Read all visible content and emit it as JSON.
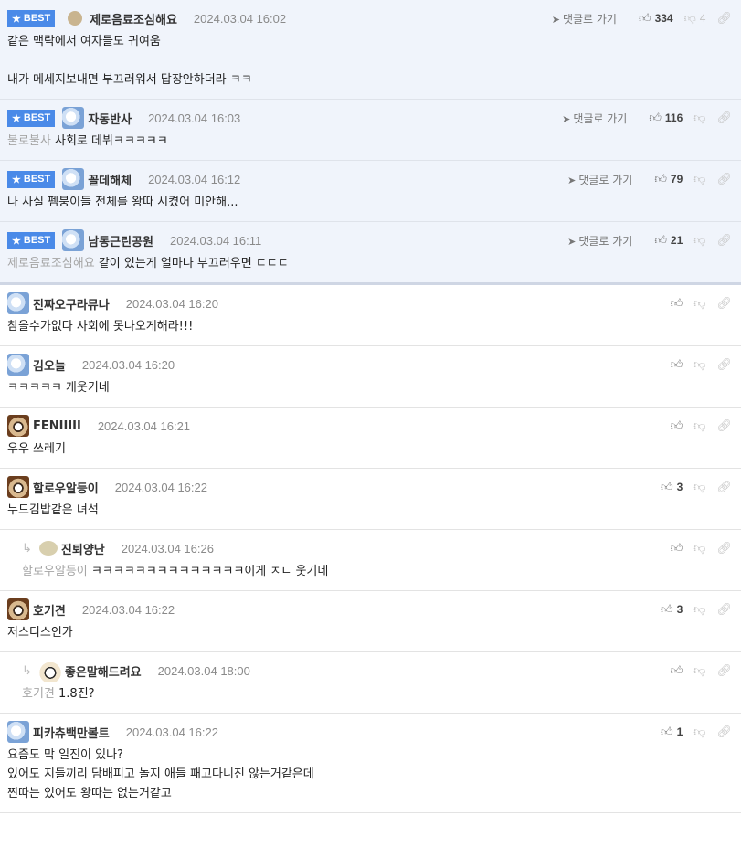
{
  "goto_label": "댓글로 가기",
  "best_label": "BEST",
  "comments": [
    {
      "kind": "best",
      "nick": "제로음료조심해요",
      "date": "2024.03.04 16:02",
      "up": "334",
      "down": "4",
      "mention": "",
      "text": "같은 맥락에서 여자들도 귀여움\n\n내가 메세지보내면 부끄러워서 답장안하더라 ㅋㅋ",
      "avatar": "round"
    },
    {
      "kind": "best",
      "nick": "자동반사",
      "date": "2024.03.04 16:03",
      "up": "116",
      "down": "",
      "mention": "불로불사",
      "text": "사회로 데뷔ㅋㅋㅋㅋㅋ",
      "avatar": "seal"
    },
    {
      "kind": "best",
      "nick": "꼴데해체",
      "date": "2024.03.04 16:12",
      "up": "79",
      "down": "",
      "mention": "",
      "text": "나 사실 펨붕이들 전체를 왕따 시켰어 미안해...",
      "avatar": "seal"
    },
    {
      "kind": "best",
      "nick": "남동근린공원",
      "date": "2024.03.04 16:11",
      "up": "21",
      "down": "",
      "mention": "제로음료조심해요",
      "text": "같이 있는게 얼마나 부끄러우면 ㄷㄷㄷ",
      "avatar": "seal"
    },
    {
      "kind": "normal",
      "nick": "진짜오구라뮤나",
      "date": "2024.03.04 16:20",
      "up": "",
      "down": "",
      "mention": "",
      "text": "참을수가없다 사회에 못나오게해라!!!",
      "avatar": "seal"
    },
    {
      "kind": "normal",
      "nick": "김오늘",
      "date": "2024.03.04 16:20",
      "up": "",
      "down": "",
      "mention": "",
      "text": "ㅋㅋㅋㅋㅋ 개웃기네",
      "avatar": "seal"
    },
    {
      "kind": "normal",
      "nick": "FENIIIII",
      "date": "2024.03.04 16:21",
      "up": "",
      "down": "",
      "mention": "",
      "text": "우우 쓰레기",
      "avatar": "dog"
    },
    {
      "kind": "normal",
      "nick": "할로우알등이",
      "date": "2024.03.04 16:22",
      "up": "3",
      "down": "",
      "mention": "",
      "text": "누드김밥같은 녀석",
      "avatar": "dog"
    },
    {
      "kind": "reply",
      "nick": "진퇴양난",
      "date": "2024.03.04 16:26",
      "up": "",
      "down": "",
      "mention": "할로우알등이",
      "text": "ㅋㅋㅋㅋㅋㅋㅋㅋㅋㅋㅋㅋㅋㅋ이게 ㅈㄴ 웃기네",
      "avatar": "round2"
    },
    {
      "kind": "normal",
      "nick": "호기견",
      "date": "2024.03.04 16:22",
      "up": "3",
      "down": "",
      "mention": "",
      "text": "저스디스인가",
      "avatar": "dog"
    },
    {
      "kind": "reply",
      "nick": "좋은말해드려요",
      "date": "2024.03.04 18:00",
      "up": "",
      "down": "",
      "mention": "호기견",
      "text": "1.8진?",
      "avatar": "fox"
    },
    {
      "kind": "normal",
      "nick": "피카츄백만볼트",
      "date": "2024.03.04 16:22",
      "up": "1",
      "down": "",
      "mention": "",
      "text": "요즘도 막 일진이 있나?\n있어도 지들끼리 담배피고 놀지 애들 패고다니진 않는거같은데\n찐따는 있어도 왕따는 없는거같고",
      "avatar": "seal"
    }
  ]
}
